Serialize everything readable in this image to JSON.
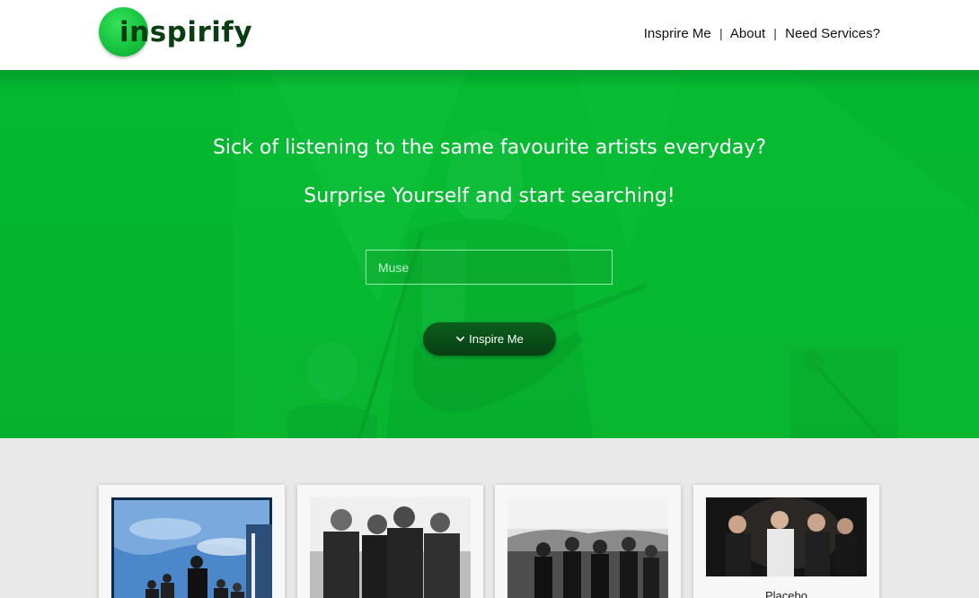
{
  "header": {
    "logo_text": "inspirify",
    "nav": {
      "inspire_me": "Insprire Me",
      "about": "About",
      "services": "Need Services?",
      "separator": "|"
    }
  },
  "hero": {
    "line1": "Sick of listening to the same favourite artists everyday?",
    "line2": "Surprise Yourself and start searching!",
    "search_placeholder": "Muse",
    "button_label": "Inspire Me"
  },
  "cards": [
    {
      "name": ""
    },
    {
      "name": ""
    },
    {
      "name": ""
    },
    {
      "name": "Placebo"
    }
  ],
  "colors": {
    "brand_green": "#0ab52f",
    "logo_text": "#0a3d12",
    "button_dark": "#0a4d18",
    "page_bg": "#e9e9e9"
  }
}
